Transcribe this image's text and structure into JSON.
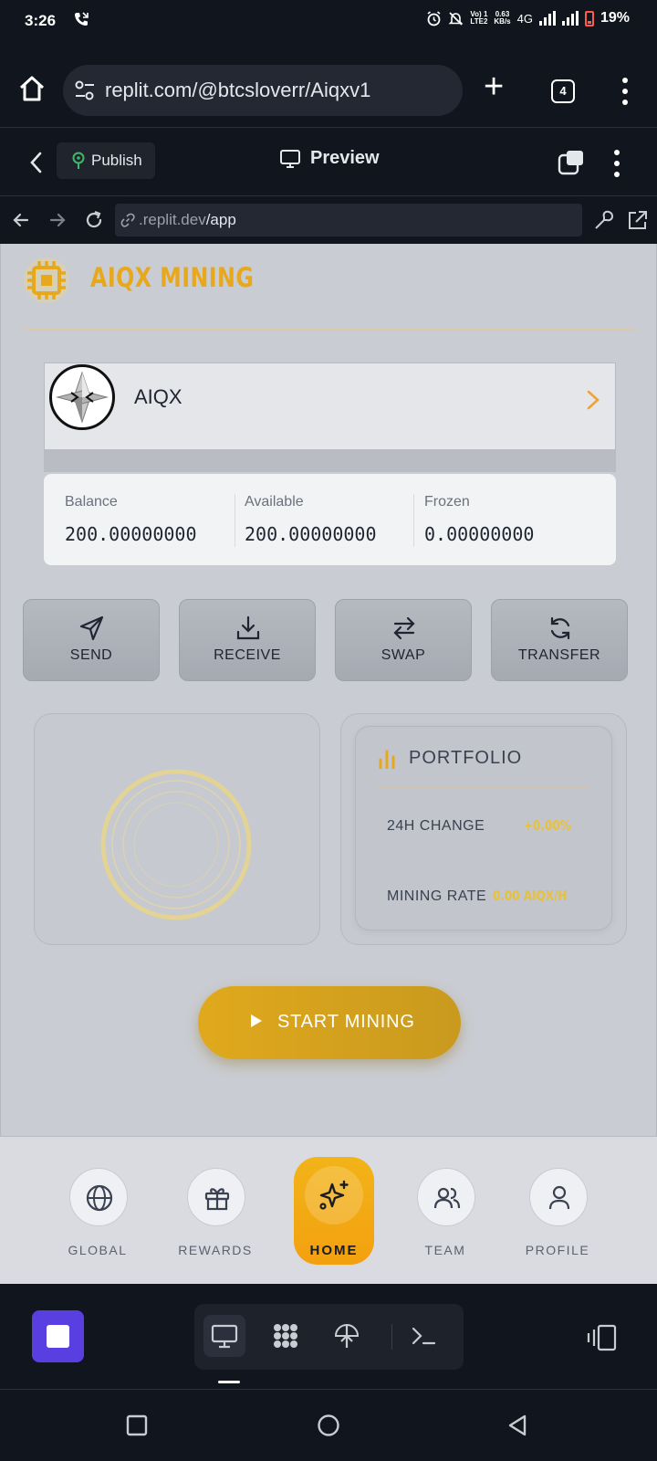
{
  "status_bar": {
    "time": "3:26",
    "net_top": "Vo) 1",
    "net_bottom": "LTE2",
    "speed_top": "0.63",
    "speed_bottom": "KB/s",
    "network": "4G",
    "battery_percent": "19%"
  },
  "browser": {
    "url": "replit.com/@btcsloverr/Aiqxv1",
    "tab_count": "4"
  },
  "replit_header": {
    "publish_label": "Publish",
    "preview_label": "Preview"
  },
  "webview": {
    "url_prefix": ".replit.dev",
    "url_path": "/app"
  },
  "app": {
    "title": "AIQX MINING",
    "coin": {
      "name": "AIQX"
    },
    "balances": [
      {
        "label": "Balance",
        "value": "200.00000000"
      },
      {
        "label": "Available",
        "value": "200.00000000"
      },
      {
        "label": "Frozen",
        "value": "0.00000000"
      }
    ],
    "actions": [
      {
        "label": "SEND",
        "icon": "send-icon"
      },
      {
        "label": "RECEIVE",
        "icon": "download-icon"
      },
      {
        "label": "SWAP",
        "icon": "swap-icon"
      },
      {
        "label": "TRANSFER",
        "icon": "refresh-icon"
      }
    ],
    "portfolio": {
      "title": "PORTFOLIO",
      "change_label": "24H CHANGE",
      "change_value": "+0.00%",
      "rate_label": "MINING RATE",
      "rate_value": "0.00 AIQX/H"
    },
    "start_button": "START MINING",
    "accent_color": "#e8a81c"
  },
  "bottom_nav": [
    {
      "label": "GLOBAL",
      "icon": "globe-icon"
    },
    {
      "label": "REWARDS",
      "icon": "gift-icon"
    },
    {
      "label": "HOME",
      "icon": "sparkles-icon",
      "active": true
    },
    {
      "label": "TEAM",
      "icon": "users-icon"
    },
    {
      "label": "PROFILE",
      "icon": "user-icon"
    }
  ],
  "replit_toolbar": {
    "tools": [
      "monitor-icon",
      "apps-grid-icon",
      "deploy-icon",
      "terminal-icon"
    ]
  }
}
